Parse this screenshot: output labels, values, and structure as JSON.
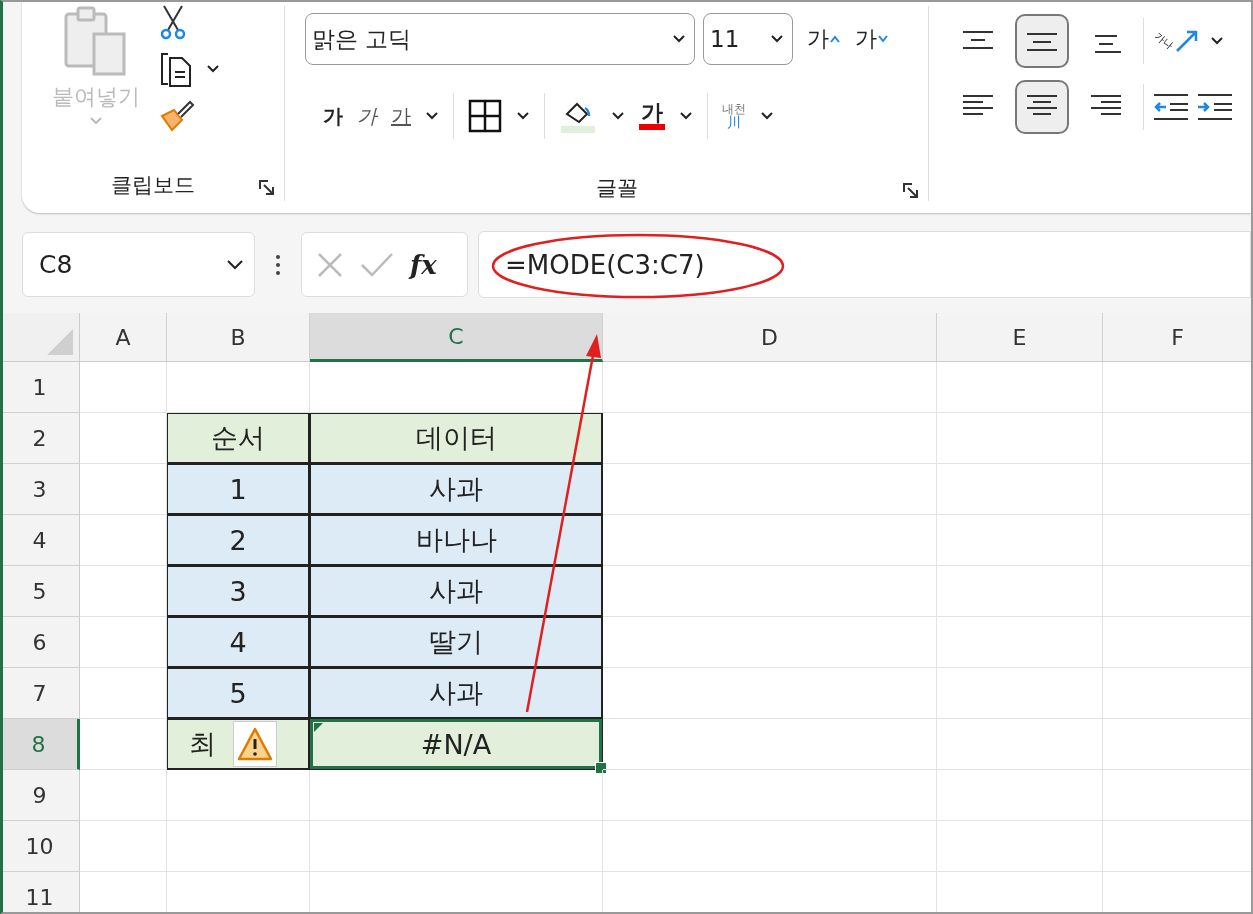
{
  "ribbon": {
    "clipboard": {
      "paste": {
        "label": "붙여넣기",
        "disabled": true
      },
      "group_label": "클립보드"
    },
    "font": {
      "font_name": "맑은 고딕",
      "font_size": "11",
      "grow_font": "가",
      "shrink_font": "가",
      "bold": "가",
      "italic": "가",
      "underline": "가",
      "font_color": "가",
      "phonetic_guide": [
        "내천",
        "川"
      ],
      "group_label": "글꼴"
    },
    "alignment": {
      "vertical": [
        {
          "kind": "top",
          "selected": false
        },
        {
          "kind": "middle",
          "selected": true
        },
        {
          "kind": "bottom",
          "selected": false
        }
      ],
      "orientation": "가나",
      "horizontal": [
        {
          "kind": "left",
          "selected": false
        },
        {
          "kind": "center",
          "selected": true
        },
        {
          "kind": "right",
          "selected": false
        }
      ]
    }
  },
  "formula_bar": {
    "name_box": "C8",
    "function_label": "fx",
    "formula": "=MODE(C3:C7)",
    "highlighted": true
  },
  "sheet": {
    "columns": [
      {
        "label": "A",
        "selected": false
      },
      {
        "label": "B",
        "selected": false
      },
      {
        "label": "C",
        "selected": true
      },
      {
        "label": "D",
        "selected": false
      },
      {
        "label": "E",
        "selected": false
      },
      {
        "label": "F",
        "selected": false
      }
    ],
    "rows": [
      {
        "label": "1",
        "selected": false
      },
      {
        "label": "2",
        "selected": false
      },
      {
        "label": "3",
        "selected": false
      },
      {
        "label": "4",
        "selected": false
      },
      {
        "label": "5",
        "selected": false
      },
      {
        "label": "6",
        "selected": false
      },
      {
        "label": "7",
        "selected": false
      },
      {
        "label": "8",
        "selected": true
      },
      {
        "label": "9",
        "selected": false
      },
      {
        "label": "10",
        "selected": false
      },
      {
        "label": "11",
        "selected": false
      }
    ],
    "table": {
      "header": [
        "순서",
        "데이터"
      ],
      "rows": [
        [
          "1",
          "사과"
        ],
        [
          "2",
          "바나나"
        ],
        [
          "3",
          "사과"
        ],
        [
          "4",
          "딸기"
        ],
        [
          "5",
          "사과"
        ]
      ],
      "footer": {
        "label": "최",
        "value": "#N/A",
        "selected": true,
        "error_warning": true
      }
    }
  }
}
